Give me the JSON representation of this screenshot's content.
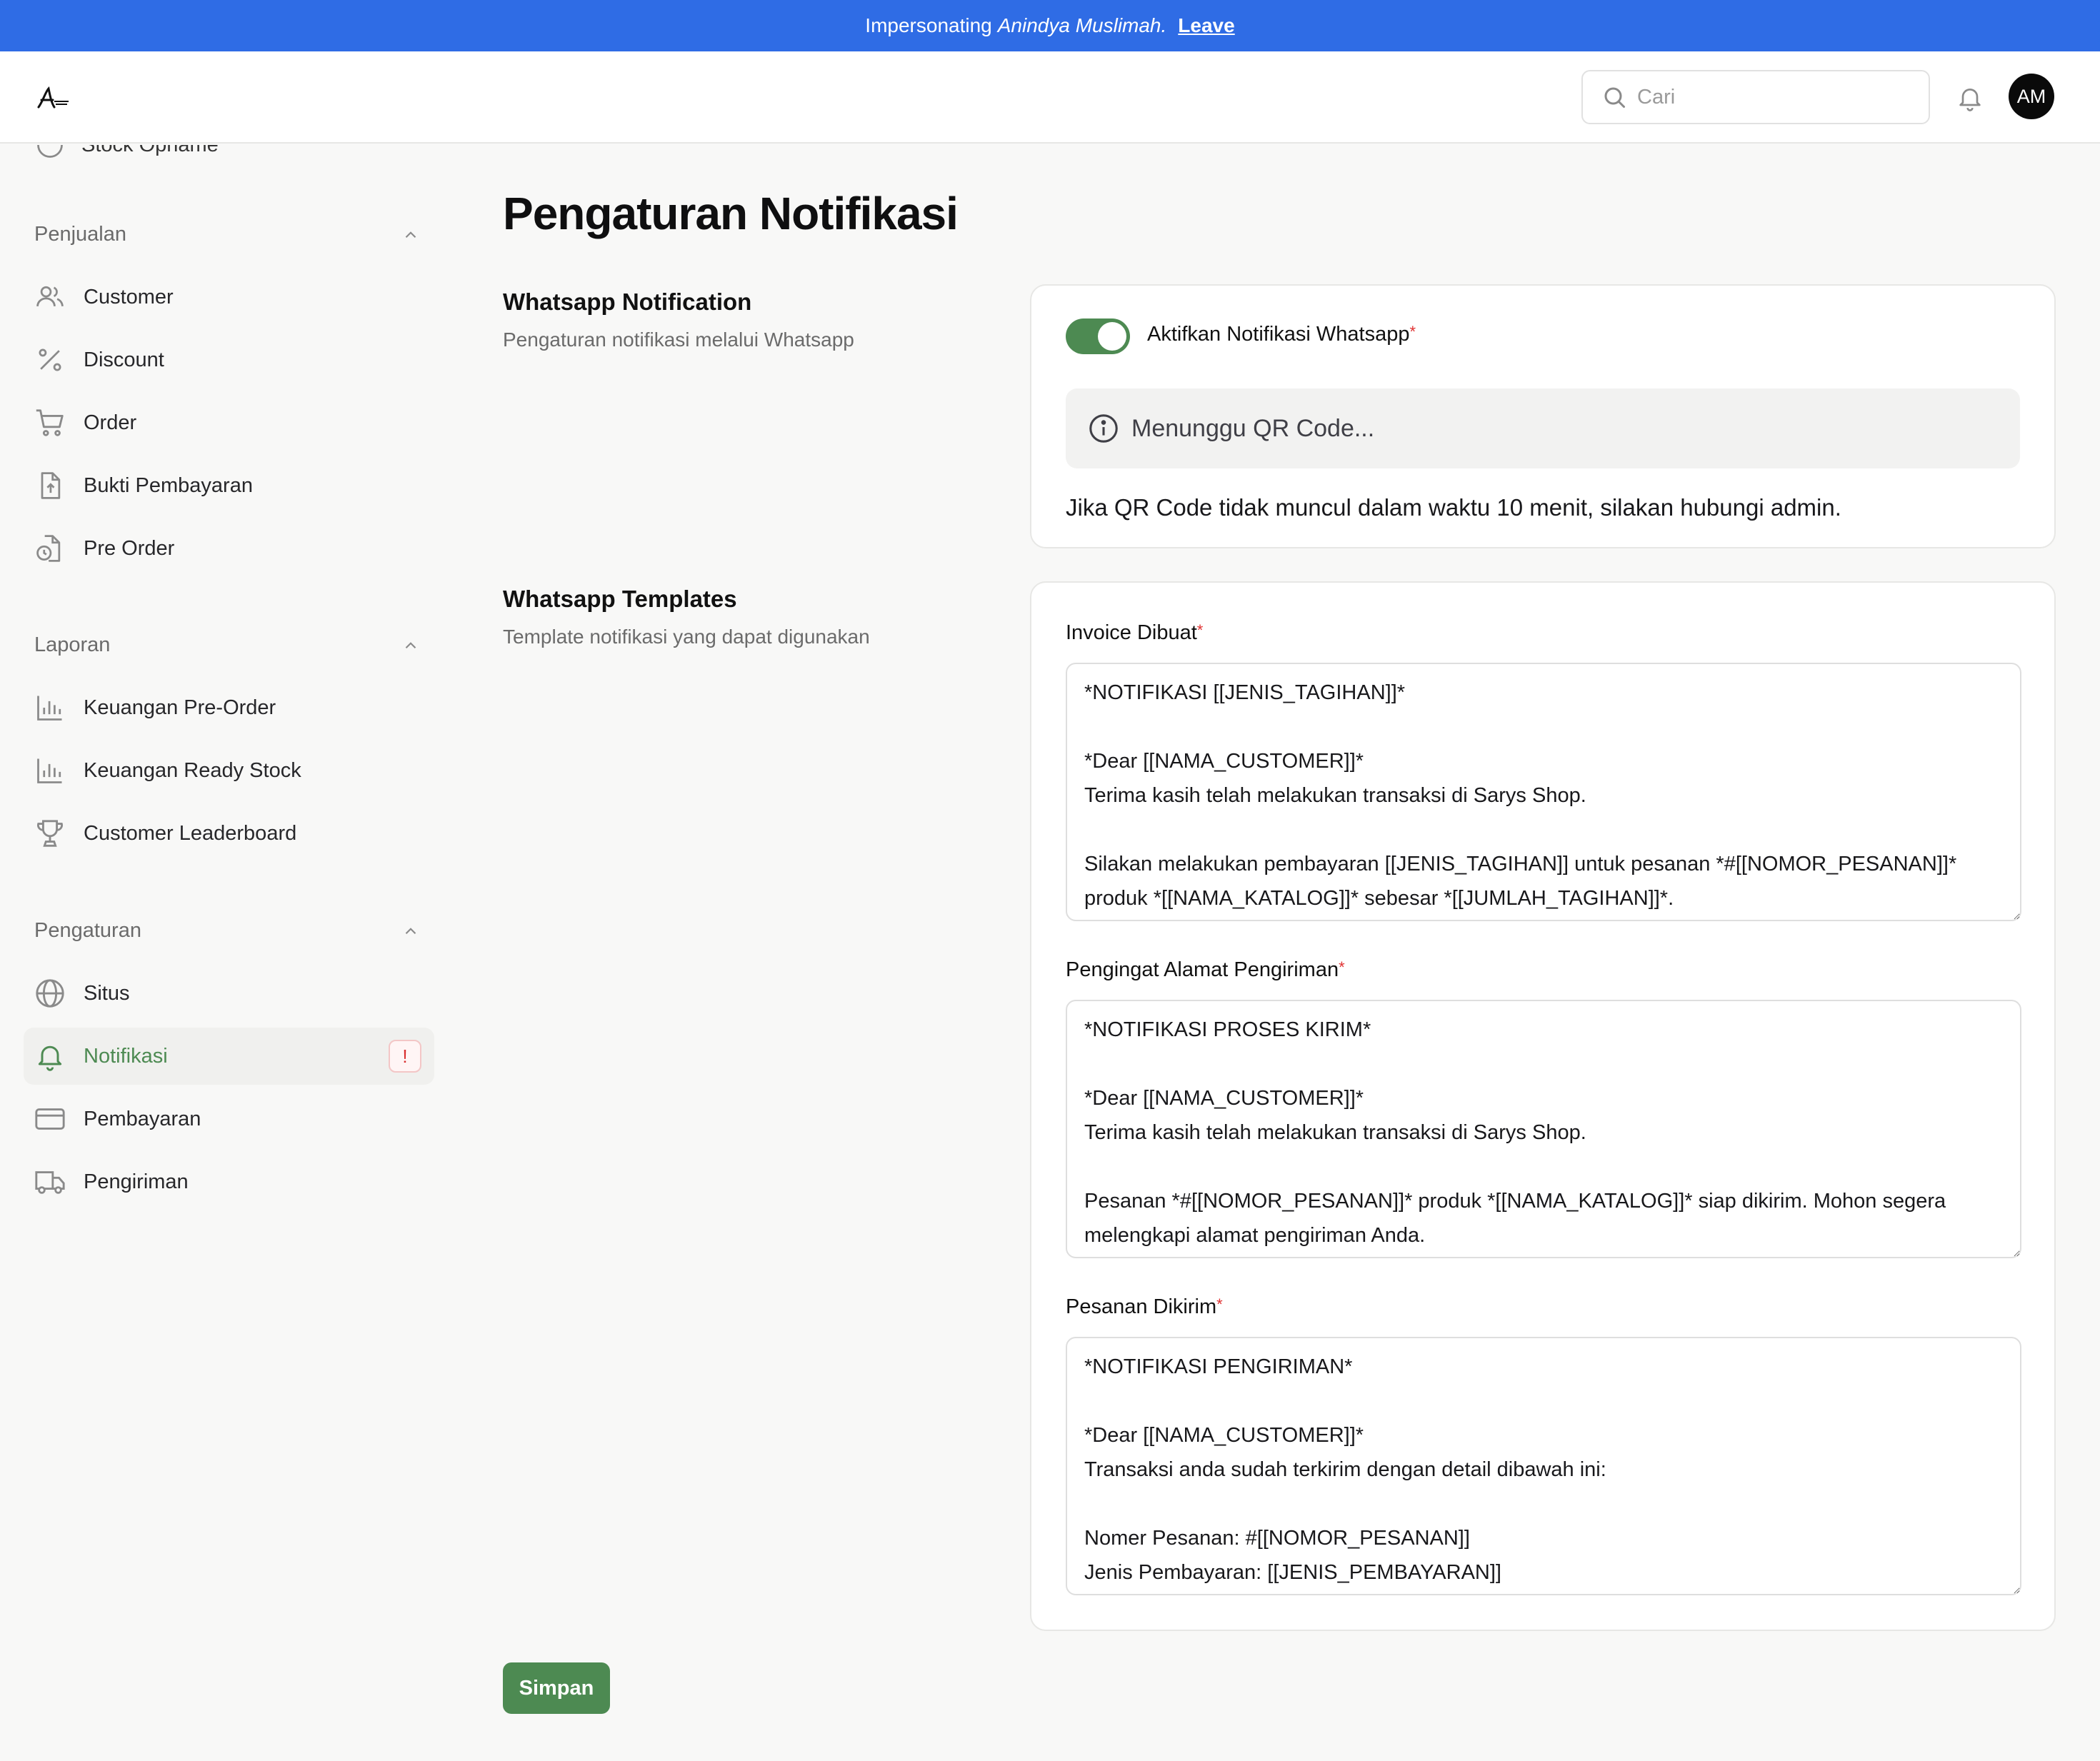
{
  "banner": {
    "prefix": "Impersonating",
    "name": "Anindya Muslimah.",
    "leave": "Leave"
  },
  "header": {
    "search_placeholder": "Cari",
    "avatar_initials": "AM"
  },
  "sidebar": {
    "partial_item": "Stock Opname",
    "groups": [
      {
        "title": "Penjualan",
        "items": [
          "Customer",
          "Discount",
          "Order",
          "Bukti Pembayaran",
          "Pre Order"
        ]
      },
      {
        "title": "Laporan",
        "items": [
          "Keuangan Pre-Order",
          "Keuangan Ready Stock",
          "Customer Leaderboard"
        ]
      },
      {
        "title": "Pengaturan",
        "items": [
          "Situs",
          "Notifikasi",
          "Pembayaran",
          "Pengiriman"
        ]
      }
    ],
    "active_item": "Notifikasi",
    "alert_badge": "!"
  },
  "page": {
    "title": "Pengaturan Notifikasi"
  },
  "whatsapp_notification": {
    "title": "Whatsapp Notification",
    "description": "Pengaturan notifikasi melalui Whatsapp",
    "toggle_label": "Aktifkan Notifikasi Whatsapp",
    "toggle_on": true,
    "required_mark": "*",
    "qr_status": "Menunggu QR Code...",
    "qr_note": "Jika QR Code tidak muncul dalam waktu 10 menit, silakan hubungi admin."
  },
  "whatsapp_templates": {
    "title": "Whatsapp Templates",
    "description": "Template notifikasi yang dapat digunakan",
    "required_mark": "*",
    "fields": [
      {
        "label": "Invoice Dibuat",
        "value": "*NOTIFIKASI [[JENIS_TAGIHAN]]*\n\n*Dear [[NAMA_CUSTOMER]]*\nTerima kasih telah melakukan transaksi di Sarys Shop.\n\nSilakan melakukan pembayaran [[JENIS_TAGIHAN]] untuk pesanan *#[[NOMOR_PESANAN]]* produk *[[NAMA_KATALOG]]* sebesar *[[JUMLAH_TAGIHAN]]*."
      },
      {
        "label": "Pengingat Alamat Pengiriman",
        "value": "*NOTIFIKASI PROSES KIRIM*\n\n*Dear [[NAMA_CUSTOMER]]*\nTerima kasih telah melakukan transaksi di Sarys Shop.\n\nPesanan *#[[NOMOR_PESANAN]]* produk *[[NAMA_KATALOG]]* siap dikirim. Mohon segera melengkapi alamat pengiriman Anda."
      },
      {
        "label": "Pesanan Dikirim",
        "value": "*NOTIFIKASI PENGIRIMAN*\n\n*Dear [[NAMA_CUSTOMER]]*\nTransaksi anda sudah terkirim dengan detail dibawah ini:\n\nNomer Pesanan: #[[NOMOR_PESANAN]]\nJenis Pembayaran: [[JENIS_PEMBAYARAN]]"
      }
    ]
  },
  "actions": {
    "save_label": "Simpan"
  },
  "colors": {
    "banner": "#2f6ce5",
    "accent": "#4d8a52",
    "alert": "#e03131"
  }
}
